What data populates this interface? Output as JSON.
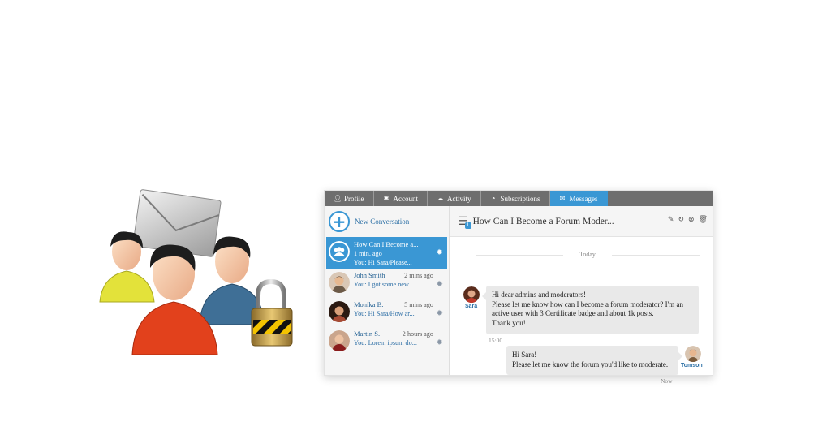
{
  "tabs": [
    {
      "label": "Profile",
      "icon": "user-icon"
    },
    {
      "label": "Account",
      "icon": "gear-icon"
    },
    {
      "label": "Activity",
      "icon": "chat-icon"
    },
    {
      "label": "Subscriptions",
      "icon": "rss-icon"
    },
    {
      "label": "Messages",
      "icon": "envelope-icon",
      "active": true
    }
  ],
  "sidebar": {
    "new_conversation": "New Conversation",
    "conversations": [
      {
        "name": "How Can I Become a...",
        "time": "1 min. ago",
        "preview": "You: Hi Sara/Please...",
        "active": true
      },
      {
        "name": "John Smith",
        "time": "2 mins ago",
        "preview": "You: I got some new..."
      },
      {
        "name": "Monika B.",
        "time": "5 mins ago",
        "preview": "You: Hi Sara/How ar..."
      },
      {
        "name": "Martin S.",
        "time": "2 hours ago",
        "preview": "You: Lorem ipsum do..."
      }
    ]
  },
  "thread": {
    "title": "How Can I Become a Forum Moder...",
    "unread_badge": "1",
    "day_separator": "Today",
    "messages": [
      {
        "author": "Sara",
        "lines": [
          "Hi dear admins and moderators!",
          "Please let me know how can I become a forum moderator? I'm an",
          "active user with 3 Certificate badge and about 1k posts.",
          "Thank you!"
        ],
        "time": "15:00"
      },
      {
        "author": "Tomson",
        "lines": [
          "Hi Sara!",
          "Please let me know the forum you'd like to moderate."
        ],
        "time": "Now"
      }
    ]
  },
  "colors": {
    "accent": "#3a97d4",
    "tabbar": "#6e6e6e",
    "bubble": "#e9e9e9"
  }
}
